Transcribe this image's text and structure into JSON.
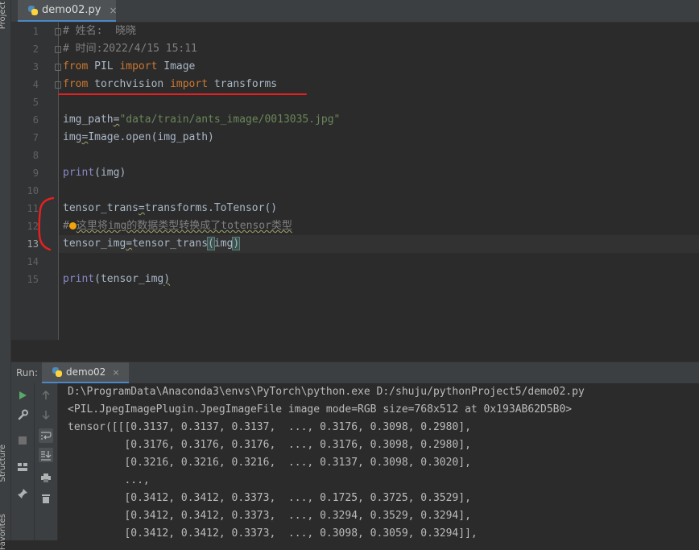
{
  "side_tabs": {
    "project": "Project",
    "structure": "Structure",
    "favorites": "Favorites"
  },
  "editor_tab": {
    "filename": "demo02.py",
    "close": "×"
  },
  "editor": {
    "lines": [
      {
        "num": "1",
        "c": "# 姓名:  晓晓"
      },
      {
        "num": "2",
        "c": "# 时间:2022/4/15 15:11"
      },
      {
        "num": "3",
        "a": "from",
        "b": " PIL ",
        "c": "import",
        "d": " Image"
      },
      {
        "num": "4",
        "a": "from",
        "b": " torchvision ",
        "c": "import",
        "d": " transforms"
      },
      {
        "num": "5"
      },
      {
        "num": "6",
        "a": "img_path",
        "b": "=",
        "c": "\"data/train/ants_image/0013035.jpg\""
      },
      {
        "num": "7",
        "a": "img",
        "b": "=",
        "c": "Image.open(img_path)"
      },
      {
        "num": "8"
      },
      {
        "num": "9",
        "a": "print",
        "b": "(img)"
      },
      {
        "num": "10"
      },
      {
        "num": "11",
        "a": "tensor_trans",
        "b": "=",
        "c": "transforms.ToTensor()"
      },
      {
        "num": "12",
        "a": "#",
        "c": "这里将img的数据类型转换成了totensor类型"
      },
      {
        "num": "13",
        "a": "tensor_img",
        "b": "=",
        "c": "tensor_trans",
        "d": "(",
        "e": "img",
        "f": ")"
      },
      {
        "num": "14"
      },
      {
        "num": "15",
        "a": "print",
        "b": "(tensor_img",
        "c": ")"
      }
    ]
  },
  "run_panel": {
    "label": "Run:",
    "tab": "demo02",
    "close": "×"
  },
  "console": {
    "lines": [
      "D:\\ProgramData\\Anaconda3\\envs\\PyTorch\\python.exe D:/shuju/pythonProject5/demo02.py",
      "<PIL.JpegImagePlugin.JpegImageFile image mode=RGB size=768x512 at 0x193AB62D5B0>",
      "tensor([[[0.3137, 0.3137, 0.3137,  ..., 0.3176, 0.3098, 0.2980],",
      "         [0.3176, 0.3176, 0.3176,  ..., 0.3176, 0.3098, 0.2980],",
      "         [0.3216, 0.3216, 0.3216,  ..., 0.3137, 0.3098, 0.3020],",
      "         ...,",
      "         [0.3412, 0.3412, 0.3373,  ..., 0.1725, 0.3725, 0.3529],",
      "         [0.3412, 0.3412, 0.3373,  ..., 0.3294, 0.3529, 0.3294],",
      "         [0.3412, 0.3412, 0.3373,  ..., 0.3098, 0.3059, 0.3294]],"
    ]
  },
  "colors": {
    "keyword": "#cc7832",
    "comment": "#808080",
    "string": "#6a8759",
    "builtin": "#8888c6",
    "text": "#a9b7c6",
    "annotation": "#e62020"
  }
}
